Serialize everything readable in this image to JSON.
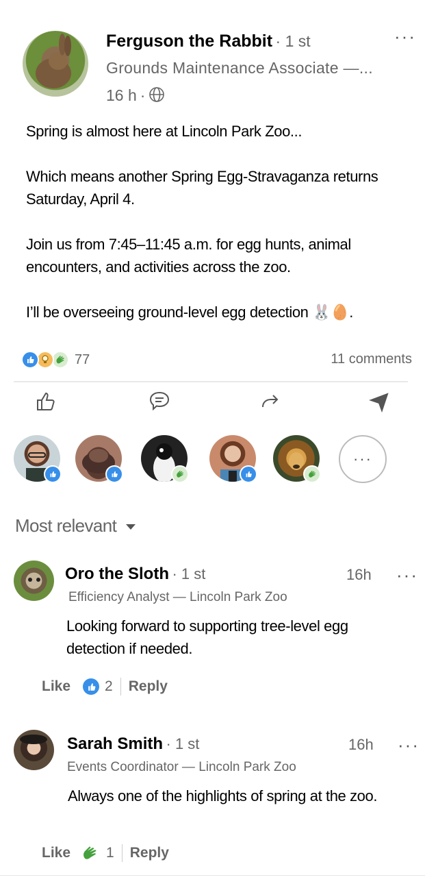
{
  "post": {
    "author": "Ferguson the Rabbit",
    "degree": "· 1 st",
    "headline": "Grounds Maintenance Associate —...",
    "time": "16 h",
    "dot": "·",
    "body": [
      "Spring is almost here at Lincoln Park Zoo...",
      "Which means another Spring Egg-Stravaganza returns Saturday, April 4.",
      "Join us from 7:45–11:45 a.m. for egg hunts, animal encounters, and activities across the zoo.",
      "I’ll be overseeing ground-level egg detection 🐰🥚."
    ],
    "reaction_count": "77",
    "comments_count": "11 comments"
  },
  "sort": {
    "label": "Most relevant"
  },
  "comments": [
    {
      "name": "Oro the Sloth",
      "degree": "· 1 st",
      "title": "Efficiency Analyst — Lincoln Park Zoo",
      "time": "16h",
      "text": "Looking forward to supporting tree-level egg detection if needed.",
      "like": "Like",
      "count": "2",
      "reply": "Reply"
    },
    {
      "name": "Sarah Smith",
      "degree": "· 1 st",
      "title": "Events Coordinator — Lincoln Park Zoo",
      "time": "16h",
      "text": "Always one of the highlights of spring at the zoo.",
      "like": "Like",
      "count": "1",
      "reply": "Reply"
    }
  ],
  "more_reactors": "···",
  "colors": {
    "like_blue": "#378fe9",
    "clap_green": "#44a13d",
    "insight_yellow": "#f5bb5c"
  }
}
